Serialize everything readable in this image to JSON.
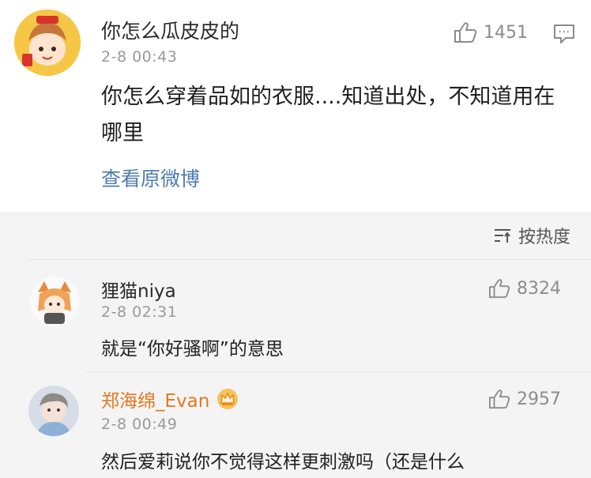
{
  "post": {
    "username": "你怎么瓜皮皮的",
    "time": "2-8 00:43",
    "likes": "1451",
    "body": "你怎么穿着品如的衣服....知道出处，不知道用在哪里",
    "link": "查看原微博"
  },
  "sort": {
    "label": "按热度"
  },
  "comments": [
    {
      "username": "狸猫niya",
      "time": "2-8 02:31",
      "likes": "8324",
      "text": "就是“你好骚啊”的意思"
    },
    {
      "username": "郑海绵_Evan",
      "time": "2-8 00:49",
      "likes": "2957",
      "text": "然后爱莉说你不觉得这样更刺激吗（还是什么"
    }
  ],
  "colors": {
    "link": "#4f7cae",
    "vip_name": "#e2791f",
    "comments_bg": "#f4f4f4"
  },
  "icons": [
    "thumbs-up-icon",
    "comment-icon",
    "sort-icon",
    "crown-icon"
  ]
}
